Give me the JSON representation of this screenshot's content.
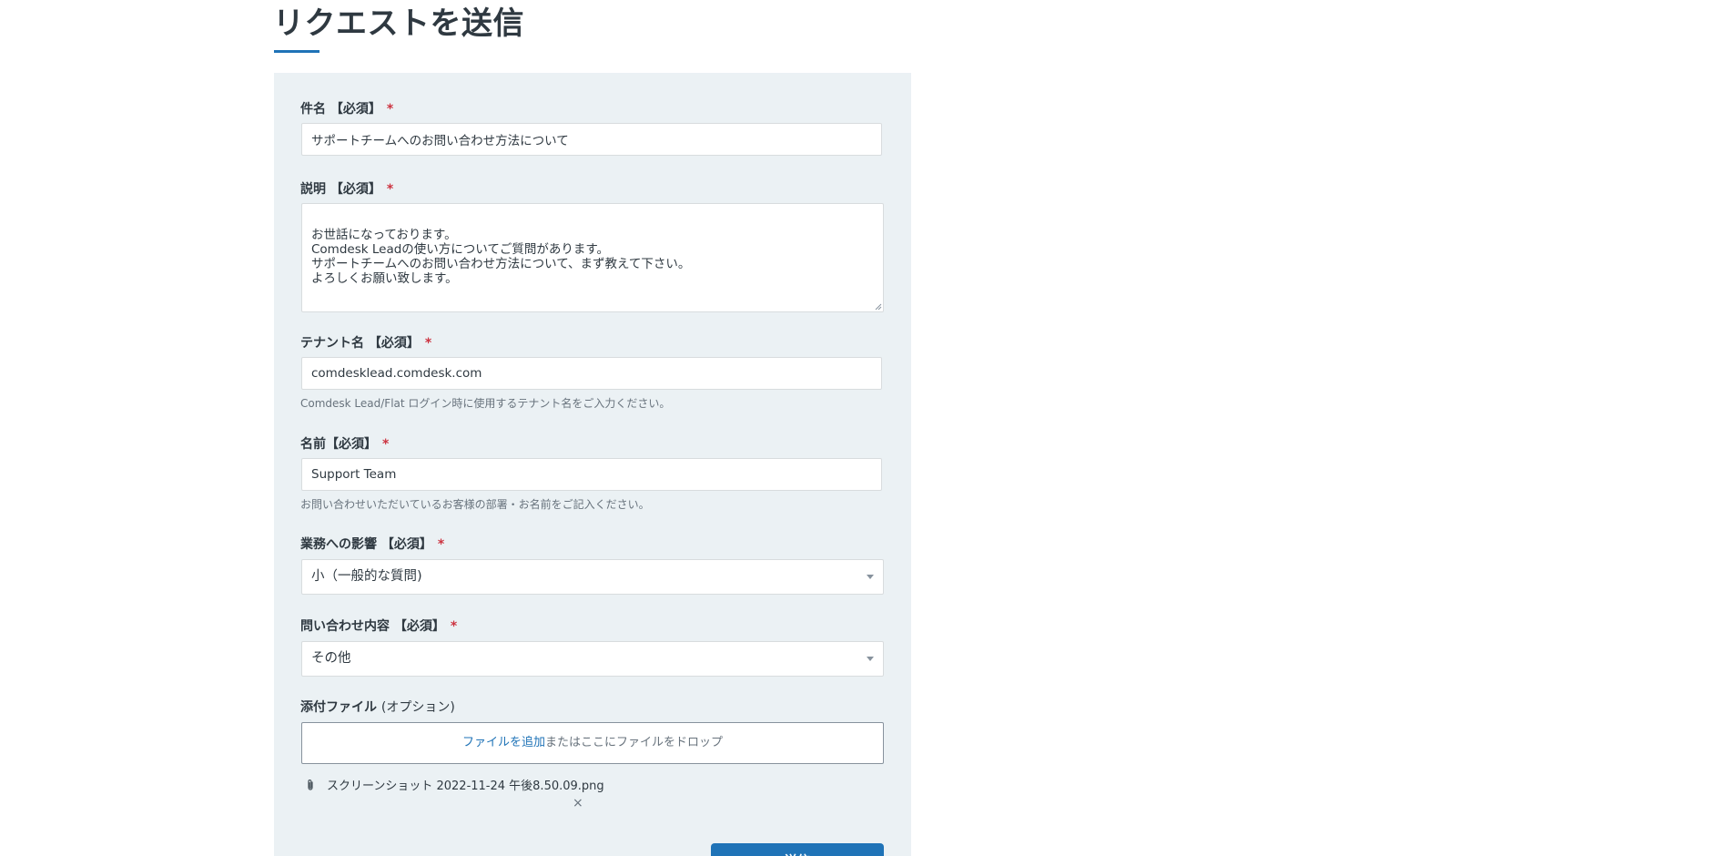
{
  "page": {
    "title": "リクエストを送信"
  },
  "fields": {
    "subject": {
      "label": "件名 【必須】",
      "required_mark": "*",
      "value": "サポートチームへのお問い合わせ方法について"
    },
    "description": {
      "label": "説明 【必須】",
      "required_mark": "*",
      "value": "お世話になっております。\nComdesk Leadの使い方についてご質問があります。\nサポートチームへのお問い合わせ方法について、まず教えて下さい。\nよろしくお願い致します。"
    },
    "tenant": {
      "label": "テナント名 【必須】",
      "required_mark": "*",
      "value": "comdesklead.comdesk.com",
      "hint": "Comdesk Lead/Flat ログイン時に使用するテナント名をご入力ください。"
    },
    "name": {
      "label": "名前【必須】",
      "required_mark": "*",
      "value": "Support Team",
      "hint": "お問い合わせいただいているお客様の部署・お名前をご記入ください。"
    },
    "impact": {
      "label": "業務への影響 【必須】",
      "required_mark": "*",
      "selected": "小（一般的な質問)"
    },
    "inquiry_type": {
      "label": "問い合わせ内容 【必須】",
      "required_mark": "*",
      "selected": "その他"
    },
    "attachments": {
      "label": "添付ファイル",
      "optional_text": "(オプション)",
      "add_link": "ファイルを追加",
      "drop_text": "またはここにファイルをドロップ",
      "files": [
        {
          "name": "スクリーンショット 2022-11-24 午後8.50.09.png",
          "remove_label": "×"
        }
      ]
    }
  },
  "actions": {
    "submit_label": "送信"
  },
  "colors": {
    "accent": "#1f73b7",
    "panel_bg": "#ebf1f4",
    "required": "#cc3340"
  },
  "icons": {
    "attachment": "paperclip-icon",
    "dropdown": "chevron-down-icon",
    "remove": "close-icon"
  }
}
